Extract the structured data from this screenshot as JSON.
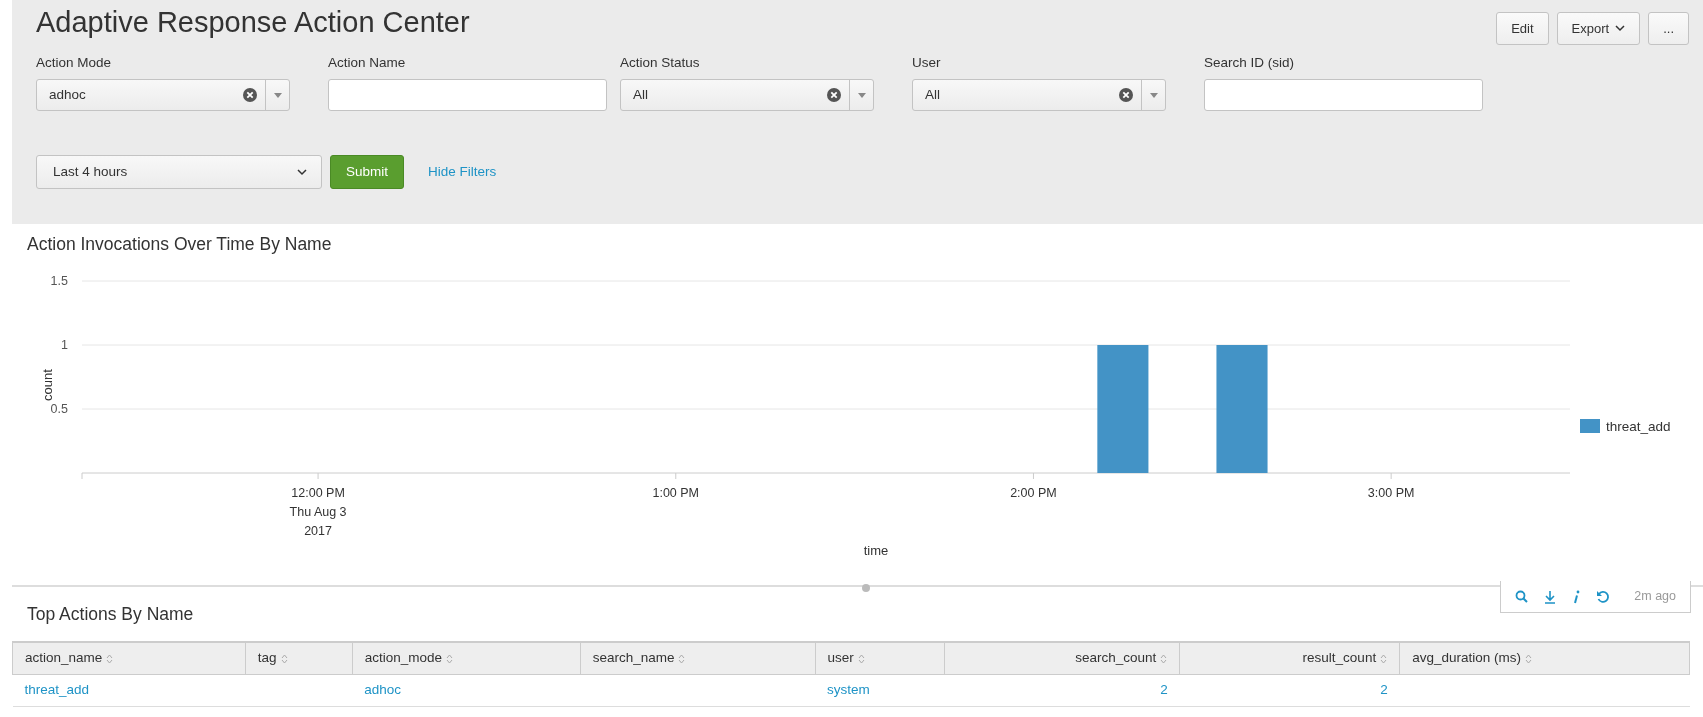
{
  "header": {
    "title": "Adaptive Response Action Center",
    "buttons": [
      {
        "label": "Edit",
        "kind": "plain"
      },
      {
        "label": "Export",
        "kind": "menu"
      },
      {
        "label": "...",
        "kind": "plain"
      }
    ]
  },
  "filters": [
    {
      "label": "Action Mode",
      "kind": "select",
      "value": "adhoc"
    },
    {
      "label": "Action Name",
      "kind": "text"
    },
    {
      "label": "Action Status",
      "kind": "select",
      "value": "All"
    },
    {
      "label": "User",
      "kind": "select",
      "value": "All"
    },
    {
      "label": "Search ID (sid)",
      "kind": "text"
    }
  ],
  "time_picker": {
    "value": "Last 4 hours"
  },
  "submit": {
    "label": "Submit"
  },
  "hide_filters": {
    "label": "Hide Filters"
  },
  "chart_panel": {
    "title": "Action Invocations Over Time By Name",
    "chart_data": {
      "type": "bar",
      "xlabel": "time",
      "ylabel": "count",
      "x": [
        14.25,
        14.583
      ],
      "series": [
        {
          "name": "threat_add",
          "color": "#4393c6",
          "values": [
            1,
            1
          ]
        }
      ],
      "xlim": [
        11.34,
        15.5
      ],
      "ylim": [
        0,
        1.5
      ],
      "xticks": [
        {
          "value": 12,
          "label": "12:00 PM\nThu Aug 3\n2017"
        },
        {
          "value": 13,
          "label": "1:00 PM"
        },
        {
          "value": 14,
          "label": "2:00 PM"
        },
        {
          "value": 15,
          "label": "3:00 PM"
        }
      ],
      "yticks": [
        0.5,
        1,
        1.5
      ]
    }
  },
  "table_panel": {
    "title": "Top Actions By Name",
    "refresh_age": "2m ago",
    "columns": [
      {
        "label": "action_name",
        "numeric": false
      },
      {
        "label": "tag",
        "numeric": false
      },
      {
        "label": "action_mode",
        "numeric": false
      },
      {
        "label": "search_name",
        "numeric": false
      },
      {
        "label": "user",
        "numeric": false
      },
      {
        "label": "search_count",
        "numeric": true
      },
      {
        "label": "result_count",
        "numeric": true
      },
      {
        "label": "avg_duration (ms)",
        "numeric": false
      }
    ],
    "rows": [
      [
        "threat_add",
        null,
        "adhoc",
        null,
        "system",
        "2",
        "2",
        null
      ]
    ]
  }
}
